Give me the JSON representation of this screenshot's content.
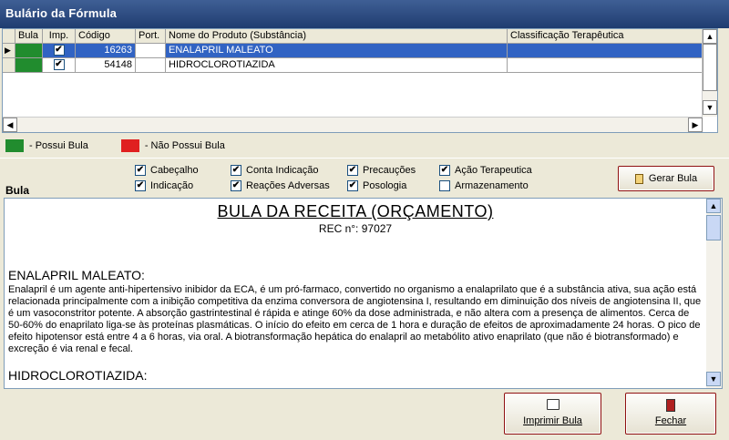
{
  "window": {
    "title": "Bulário da Fórmula"
  },
  "grid": {
    "columns": [
      "Bula",
      "Imp.",
      "Código",
      "Port.",
      "Nome do Produto (Substância)",
      "Classificação Terapêutica"
    ],
    "rows": [
      {
        "imp_check": "✔",
        "codigo": "16263",
        "port": "",
        "nome": "ENALAPRIL MALEATO",
        "classificacao": ""
      },
      {
        "imp_check": "✔",
        "codigo": "54148",
        "port": "",
        "nome": "HIDROCLOROTIAZIDA",
        "classificacao": ""
      }
    ]
  },
  "legend": {
    "possui": "- Possui Bula",
    "nao_possui": "- Não Possui Bula",
    "possui_color": "#218c2e",
    "nao_possui_color": "#e02020"
  },
  "options": {
    "section_label": "Bula",
    "check_mark": "✔",
    "items": [
      {
        "label": "Cabeçalho",
        "checked": true
      },
      {
        "label": "Indicação",
        "checked": true
      },
      {
        "label": "Conta Indicação",
        "checked": true
      },
      {
        "label": "Reações Adversas",
        "checked": true
      },
      {
        "label": "Precauções",
        "checked": true
      },
      {
        "label": "Posologia",
        "checked": true
      },
      {
        "label": "Ação Terapeutica",
        "checked": true
      },
      {
        "label": "Armazenamento",
        "checked": false
      }
    ],
    "gerar_label": "Gerar Bula"
  },
  "document": {
    "title": "BULA DA RECEITA (ORÇAMENTO)",
    "rec": "REC n°: 97027",
    "drug1_title": "ENALAPRIL MALEATO:",
    "drug1_text": "Enalapril é um agente anti-hipertensivo inibidor da ECA, é um pró-farmaco, convertido no organismo a enalaprilato que é a substância ativa, sua ação está relacionada principalmente com a inibição competitiva da enzima conversora de angiotensina I, resultando em diminuição dos níveis de angiotensina II, que é um vasoconstritor potente. A absorção gastrintestinal é rápida e atinge 60% da dose administrada, e não altera com a presença de alimentos. Cerca de 50-60% do enaprilato liga-se às proteínas plasmáticas. O início do efeito em cerca de 1 hora e duração de efeitos de aproximadamente 24 horas. O pico de efeito hipotensor está entre 4 a 6 horas, via oral. A biotransformação hepática do enalapril ao metabólito ativo enaprilato (que não é biotransformado) e excreção é via renal e fecal.",
    "drug2_title": "HIDROCLOROTIAZIDA:"
  },
  "buttons": {
    "imprimir": "Imprimir Bula",
    "fechar": "Fechar"
  }
}
